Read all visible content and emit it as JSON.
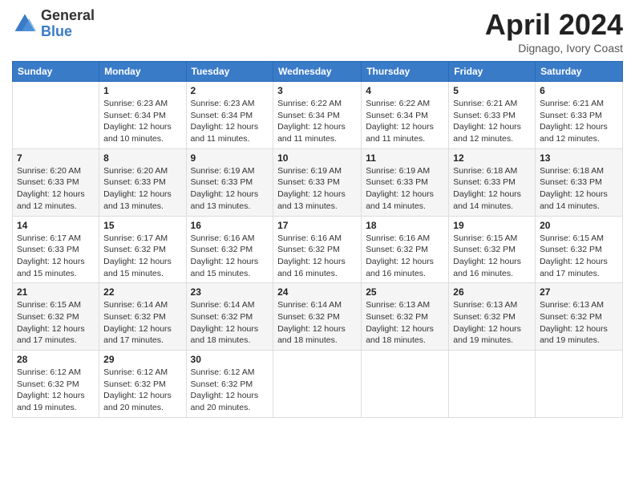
{
  "header": {
    "logo_general": "General",
    "logo_blue": "Blue",
    "title": "April 2024",
    "location": "Dignago, Ivory Coast"
  },
  "days_of_week": [
    "Sunday",
    "Monday",
    "Tuesday",
    "Wednesday",
    "Thursday",
    "Friday",
    "Saturday"
  ],
  "weeks": [
    [
      {
        "day": "",
        "info": ""
      },
      {
        "day": "1",
        "info": "Sunrise: 6:23 AM\nSunset: 6:34 PM\nDaylight: 12 hours\nand 10 minutes."
      },
      {
        "day": "2",
        "info": "Sunrise: 6:23 AM\nSunset: 6:34 PM\nDaylight: 12 hours\nand 11 minutes."
      },
      {
        "day": "3",
        "info": "Sunrise: 6:22 AM\nSunset: 6:34 PM\nDaylight: 12 hours\nand 11 minutes."
      },
      {
        "day": "4",
        "info": "Sunrise: 6:22 AM\nSunset: 6:34 PM\nDaylight: 12 hours\nand 11 minutes."
      },
      {
        "day": "5",
        "info": "Sunrise: 6:21 AM\nSunset: 6:33 PM\nDaylight: 12 hours\nand 12 minutes."
      },
      {
        "day": "6",
        "info": "Sunrise: 6:21 AM\nSunset: 6:33 PM\nDaylight: 12 hours\nand 12 minutes."
      }
    ],
    [
      {
        "day": "7",
        "info": "Sunrise: 6:20 AM\nSunset: 6:33 PM\nDaylight: 12 hours\nand 12 minutes."
      },
      {
        "day": "8",
        "info": "Sunrise: 6:20 AM\nSunset: 6:33 PM\nDaylight: 12 hours\nand 13 minutes."
      },
      {
        "day": "9",
        "info": "Sunrise: 6:19 AM\nSunset: 6:33 PM\nDaylight: 12 hours\nand 13 minutes."
      },
      {
        "day": "10",
        "info": "Sunrise: 6:19 AM\nSunset: 6:33 PM\nDaylight: 12 hours\nand 13 minutes."
      },
      {
        "day": "11",
        "info": "Sunrise: 6:19 AM\nSunset: 6:33 PM\nDaylight: 12 hours\nand 14 minutes."
      },
      {
        "day": "12",
        "info": "Sunrise: 6:18 AM\nSunset: 6:33 PM\nDaylight: 12 hours\nand 14 minutes."
      },
      {
        "day": "13",
        "info": "Sunrise: 6:18 AM\nSunset: 6:33 PM\nDaylight: 12 hours\nand 14 minutes."
      }
    ],
    [
      {
        "day": "14",
        "info": "Sunrise: 6:17 AM\nSunset: 6:33 PM\nDaylight: 12 hours\nand 15 minutes."
      },
      {
        "day": "15",
        "info": "Sunrise: 6:17 AM\nSunset: 6:32 PM\nDaylight: 12 hours\nand 15 minutes."
      },
      {
        "day": "16",
        "info": "Sunrise: 6:16 AM\nSunset: 6:32 PM\nDaylight: 12 hours\nand 15 minutes."
      },
      {
        "day": "17",
        "info": "Sunrise: 6:16 AM\nSunset: 6:32 PM\nDaylight: 12 hours\nand 16 minutes."
      },
      {
        "day": "18",
        "info": "Sunrise: 6:16 AM\nSunset: 6:32 PM\nDaylight: 12 hours\nand 16 minutes."
      },
      {
        "day": "19",
        "info": "Sunrise: 6:15 AM\nSunset: 6:32 PM\nDaylight: 12 hours\nand 16 minutes."
      },
      {
        "day": "20",
        "info": "Sunrise: 6:15 AM\nSunset: 6:32 PM\nDaylight: 12 hours\nand 17 minutes."
      }
    ],
    [
      {
        "day": "21",
        "info": "Sunrise: 6:15 AM\nSunset: 6:32 PM\nDaylight: 12 hours\nand 17 minutes."
      },
      {
        "day": "22",
        "info": "Sunrise: 6:14 AM\nSunset: 6:32 PM\nDaylight: 12 hours\nand 17 minutes."
      },
      {
        "day": "23",
        "info": "Sunrise: 6:14 AM\nSunset: 6:32 PM\nDaylight: 12 hours\nand 18 minutes."
      },
      {
        "day": "24",
        "info": "Sunrise: 6:14 AM\nSunset: 6:32 PM\nDaylight: 12 hours\nand 18 minutes."
      },
      {
        "day": "25",
        "info": "Sunrise: 6:13 AM\nSunset: 6:32 PM\nDaylight: 12 hours\nand 18 minutes."
      },
      {
        "day": "26",
        "info": "Sunrise: 6:13 AM\nSunset: 6:32 PM\nDaylight: 12 hours\nand 19 minutes."
      },
      {
        "day": "27",
        "info": "Sunrise: 6:13 AM\nSunset: 6:32 PM\nDaylight: 12 hours\nand 19 minutes."
      }
    ],
    [
      {
        "day": "28",
        "info": "Sunrise: 6:12 AM\nSunset: 6:32 PM\nDaylight: 12 hours\nand 19 minutes."
      },
      {
        "day": "29",
        "info": "Sunrise: 6:12 AM\nSunset: 6:32 PM\nDaylight: 12 hours\nand 20 minutes."
      },
      {
        "day": "30",
        "info": "Sunrise: 6:12 AM\nSunset: 6:32 PM\nDaylight: 12 hours\nand 20 minutes."
      },
      {
        "day": "",
        "info": ""
      },
      {
        "day": "",
        "info": ""
      },
      {
        "day": "",
        "info": ""
      },
      {
        "day": "",
        "info": ""
      }
    ]
  ]
}
